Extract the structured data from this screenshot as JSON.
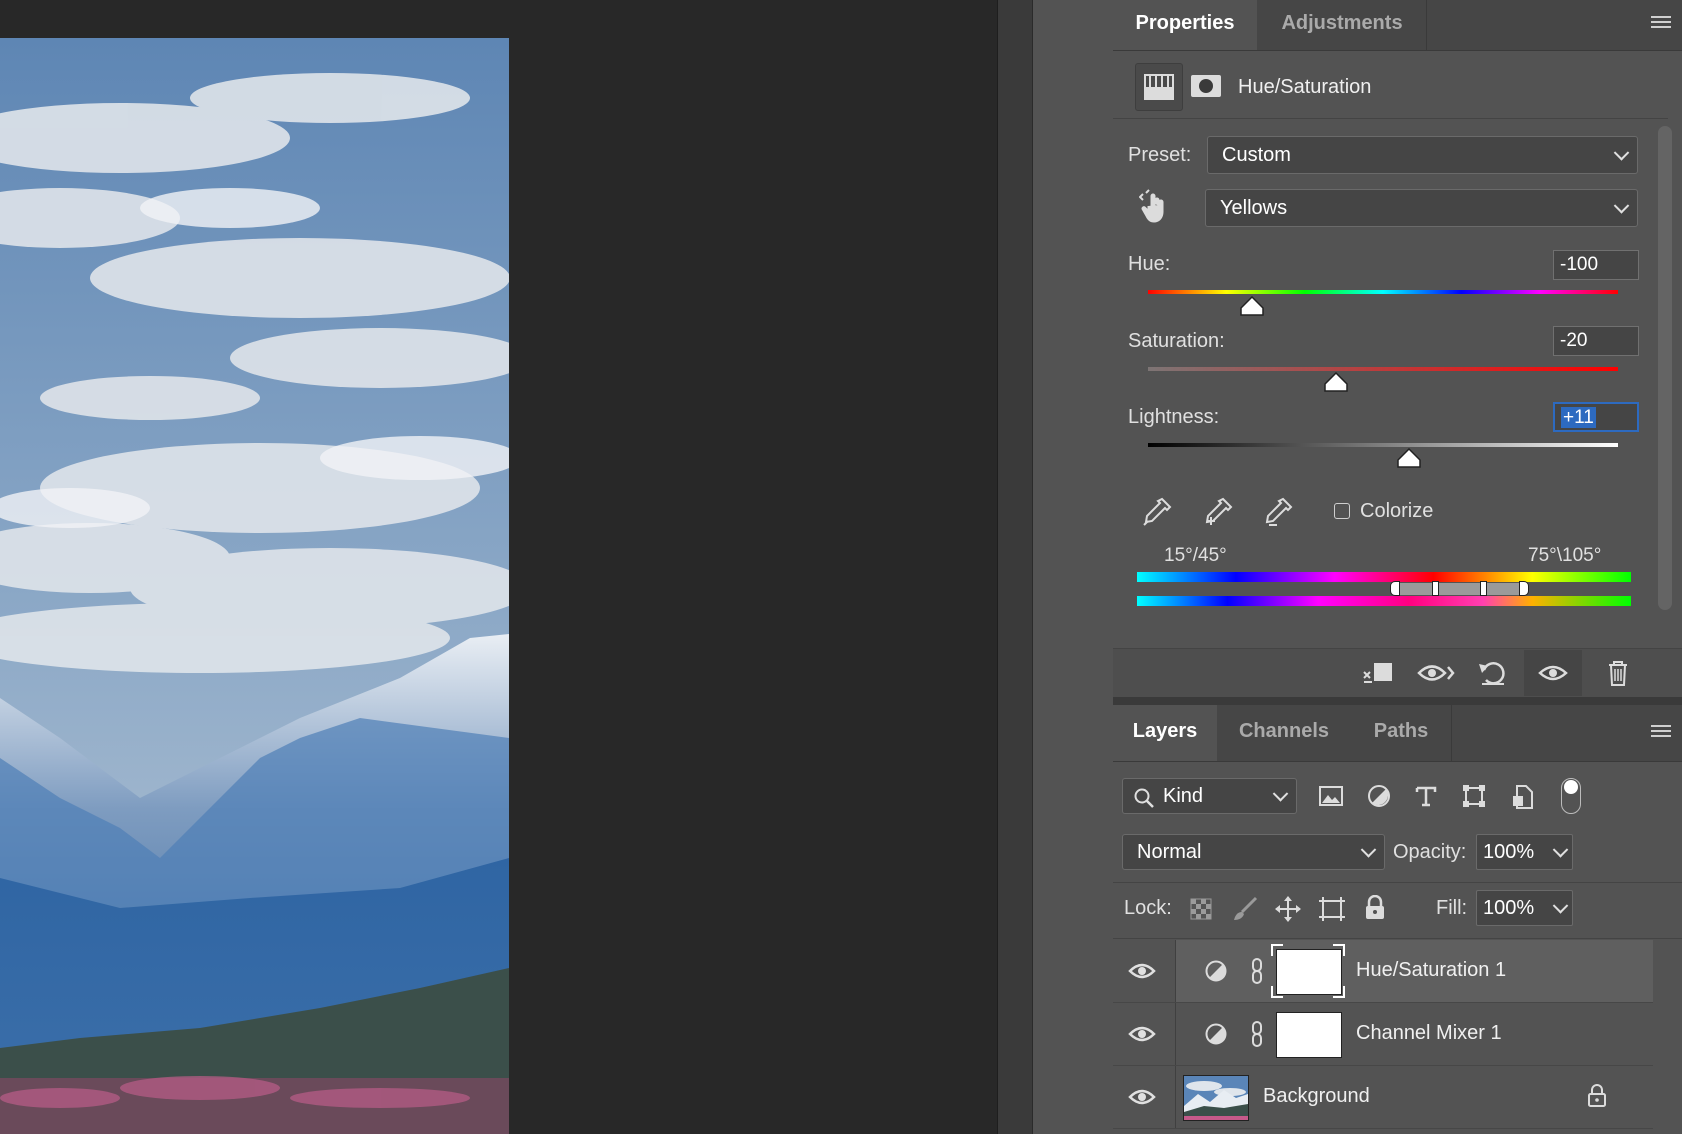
{
  "properties_panel": {
    "tabs": [
      {
        "label": "Properties",
        "active": true
      },
      {
        "label": "Adjustments",
        "active": false
      }
    ],
    "adjustment_title": "Hue/Saturation",
    "preset_label": "Preset:",
    "preset_value": "Custom",
    "channel_value": "Yellows",
    "hue": {
      "label": "Hue:",
      "value": "-100",
      "level": -100
    },
    "saturation": {
      "label": "Saturation:",
      "value": "-20",
      "level": -20
    },
    "lightness": {
      "label": "Lightness:",
      "value": "+11",
      "level": 11
    },
    "colorize_label": "Colorize",
    "colorize_checked": false,
    "range_left": "15°/45°",
    "range_right": "75°\\105°"
  },
  "footer_icons": [
    "clip-to-layer-icon",
    "view-previous-state-icon",
    "reset-icon",
    "toggle-visibility-icon",
    "delete-icon"
  ],
  "layers_panel": {
    "tabs": [
      {
        "label": "Layers",
        "active": true
      },
      {
        "label": "Channels",
        "active": false
      },
      {
        "label": "Paths",
        "active": false
      }
    ],
    "filter_kind": "Kind",
    "blend_mode": "Normal",
    "opacity_label": "Opacity:",
    "opacity_value": "100%",
    "lock_label": "Lock:",
    "fill_label": "Fill:",
    "fill_value": "100%",
    "layers": [
      {
        "name": "Hue/Saturation 1",
        "type": "adjustment",
        "selected": true,
        "visible": true
      },
      {
        "name": "Channel Mixer 1",
        "type": "adjustment",
        "selected": false,
        "visible": true
      },
      {
        "name": "Background",
        "type": "image",
        "selected": false,
        "visible": true,
        "locked": true
      }
    ]
  },
  "colors": {
    "panel_bg": "#535353",
    "tab_bar_bg": "#464646",
    "selection_highlight": "#2d6ac0",
    "selected_layer_bg": "#5e5e5e"
  }
}
